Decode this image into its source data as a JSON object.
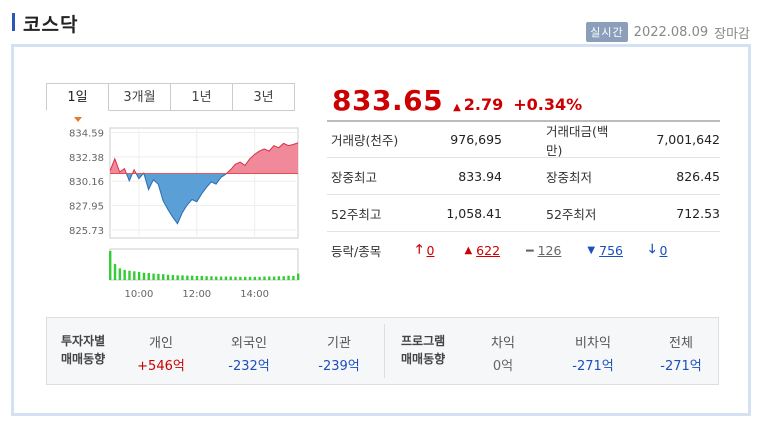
{
  "header": {
    "title": "코스닥",
    "live_badge": "실시간",
    "date": "2022.08.09",
    "status": "장마감"
  },
  "tabs": [
    {
      "label": "1일",
      "active": true
    },
    {
      "label": "3개월",
      "active": false
    },
    {
      "label": "1년",
      "active": false
    },
    {
      "label": "3년",
      "active": false
    }
  ],
  "quote": {
    "price": "833.65",
    "change": "2.79",
    "change_pct": "+0.34%",
    "up_color": "#cc0000",
    "down_color": "#1a4fc0"
  },
  "stats": {
    "rows": [
      {
        "label": "거래량(천주)",
        "value": "976,695",
        "label2": "거래대금(백만)",
        "value2": "7,001,642"
      },
      {
        "label": "장중최고",
        "value": "833.94",
        "label2": "장중최저",
        "value2": "826.45"
      },
      {
        "label": "52주최고",
        "value": "1,058.41",
        "label2": "52주최저",
        "value2": "712.53"
      }
    ],
    "advance_label": "등락/종목",
    "advance": {
      "upper_limit": "0",
      "rising": "622",
      "unchanged": "126",
      "falling": "756",
      "lower_limit": "0"
    }
  },
  "investors": {
    "heading_line1": "투자자별",
    "heading_line2": "매매동향",
    "cols": [
      {
        "label": "개인",
        "value": "+546억",
        "dir": "up"
      },
      {
        "label": "외국인",
        "value": "-232억",
        "dir": "down"
      },
      {
        "label": "기관",
        "value": "-239억",
        "dir": "down"
      }
    ]
  },
  "program": {
    "heading_line1": "프로그램",
    "heading_line2": "매매동향",
    "cols": [
      {
        "label": "차익",
        "value": "0억",
        "dir": "flat"
      },
      {
        "label": "비차익",
        "value": "-271억",
        "dir": "down"
      },
      {
        "label": "전체",
        "value": "-271억",
        "dir": "down"
      }
    ]
  },
  "chart_data": {
    "type": "area",
    "title": "",
    "xlabel": "",
    "ylabel": "",
    "baseline": 830.86,
    "ylim": [
      825.0,
      835.0
    ],
    "y_ticks": [
      "834.59",
      "832.38",
      "830.16",
      "827.95",
      "825.73"
    ],
    "x_ticks": [
      "10:00",
      "12:00",
      "14:00"
    ],
    "x_range": [
      "09:00",
      "15:30"
    ],
    "grid": true,
    "series": [
      {
        "x": [
          "09:00",
          "09:10",
          "09:20",
          "09:30",
          "09:40",
          "09:50",
          "10:00",
          "10:10",
          "10:20",
          "10:30",
          "10:40",
          "10:50",
          "11:00",
          "11:10",
          "11:20",
          "11:30",
          "11:40",
          "11:50",
          "12:00",
          "12:10",
          "12:20",
          "12:30",
          "12:40",
          "12:50",
          "13:00",
          "13:10",
          "13:20",
          "13:30",
          "13:40",
          "13:50",
          "14:00",
          "14:10",
          "14:20",
          "14:30",
          "14:40",
          "14:50",
          "15:00",
          "15:10",
          "15:20",
          "15:30"
        ],
        "values": [
          831.1,
          832.2,
          831.0,
          831.3,
          830.2,
          831.2,
          830.4,
          830.9,
          829.4,
          830.3,
          829.9,
          828.4,
          827.6,
          826.9,
          826.3,
          827.3,
          828.0,
          828.5,
          828.3,
          829.0,
          829.6,
          830.1,
          829.9,
          830.5,
          830.8,
          831.2,
          831.7,
          831.9,
          831.6,
          832.2,
          832.6,
          832.9,
          833.1,
          832.9,
          833.4,
          833.2,
          833.6,
          833.4,
          833.5,
          833.65
        ]
      }
    ],
    "volume": {
      "x": [
        "09:00",
        "09:10",
        "09:20",
        "09:30",
        "09:40",
        "09:50",
        "10:00",
        "10:10",
        "10:20",
        "10:30",
        "10:40",
        "10:50",
        "11:00",
        "11:10",
        "11:20",
        "11:30",
        "11:40",
        "11:50",
        "12:00",
        "12:10",
        "12:20",
        "12:30",
        "12:40",
        "12:50",
        "13:00",
        "13:10",
        "13:20",
        "13:30",
        "13:40",
        "13:50",
        "14:00",
        "14:10",
        "14:20",
        "14:30",
        "14:40",
        "14:50",
        "15:00",
        "15:10",
        "15:20",
        "15:30"
      ],
      "values": [
        100,
        55,
        40,
        35,
        32,
        30,
        28,
        25,
        24,
        22,
        21,
        20,
        18,
        17,
        16,
        16,
        15,
        15,
        14,
        14,
        13,
        13,
        12,
        12,
        12,
        12,
        11,
        11,
        11,
        11,
        11,
        11,
        12,
        12,
        12,
        13,
        13,
        15,
        14,
        22
      ]
    },
    "up_fill": "#f08a9a",
    "down_fill": "#5a9fd6",
    "volume_color": "#33cc33"
  }
}
